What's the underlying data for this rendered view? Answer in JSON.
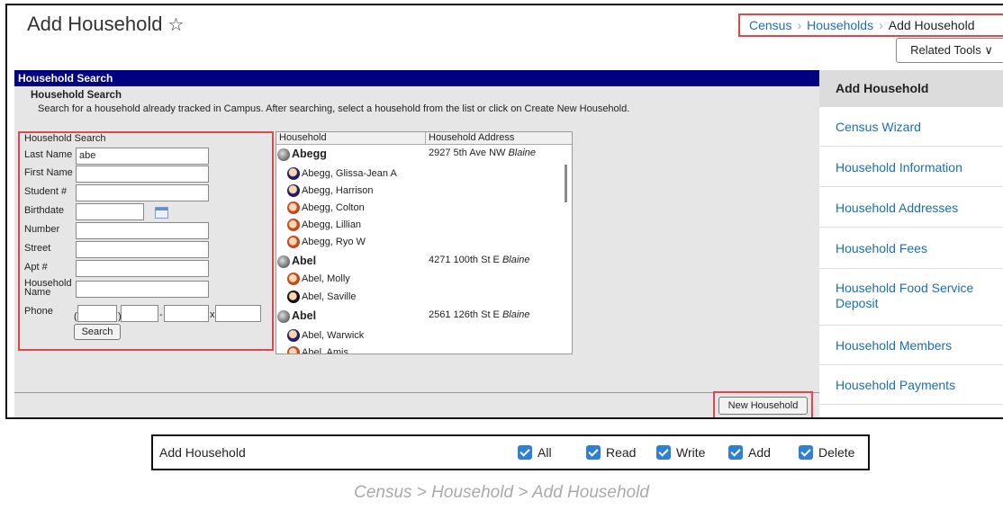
{
  "page": {
    "title": "Add Household",
    "related_tools": "Related Tools"
  },
  "breadcrumb": [
    "Census",
    "Households",
    "Add Household"
  ],
  "panel": {
    "header": "Household Search",
    "subheader": "Household Search",
    "description": "Search for a household already tracked in Campus. After searching, select a household from the list or click on Create New Household."
  },
  "form": {
    "title": "Household Search",
    "last_name_label": "Last Name",
    "last_name_value": "abe",
    "first_name_label": "First Name",
    "student_label": "Student #",
    "birthdate_label": "Birthdate",
    "number_label": "Number",
    "street_label": "Street",
    "apt_label": "Apt #",
    "household_name_label": "Household Name",
    "phone_label": "Phone",
    "phone_open": "(",
    "phone_close": ")",
    "phone_dash": "-",
    "phone_ext": "x",
    "search_button": "Search"
  },
  "results": {
    "col_household": "Household",
    "col_address": "Household Address",
    "households": [
      {
        "name": "Abegg",
        "address": "2927 5th Ave NW",
        "city": "Blaine",
        "members": [
          "Abegg, Glissa-Jean A",
          "Abegg, Harrison",
          "Abegg, Colton",
          "Abegg, Lillian",
          "Abegg, Ryo W"
        ]
      },
      {
        "name": "Abel",
        "address": "4271 100th St E",
        "city": "Blaine",
        "members": [
          "Abel, Molly",
          "Abel, Saville"
        ]
      },
      {
        "name": "Abel",
        "address": "2561 126th St E",
        "city": "Blaine",
        "members": [
          "Abel, Warwick",
          "Abel, Amis"
        ]
      }
    ]
  },
  "new_household_button": "New Household",
  "sidebar": [
    "Add Household",
    "Census Wizard",
    "Household Information",
    "Household Addresses",
    "Household Fees",
    "Household Food Service Deposit",
    "Household Members",
    "Household Payments"
  ],
  "permissions": {
    "label": "Add Household",
    "items": [
      "All",
      "Read",
      "Write",
      "Add",
      "Delete"
    ]
  },
  "caption": "Census > Household > Add Household"
}
